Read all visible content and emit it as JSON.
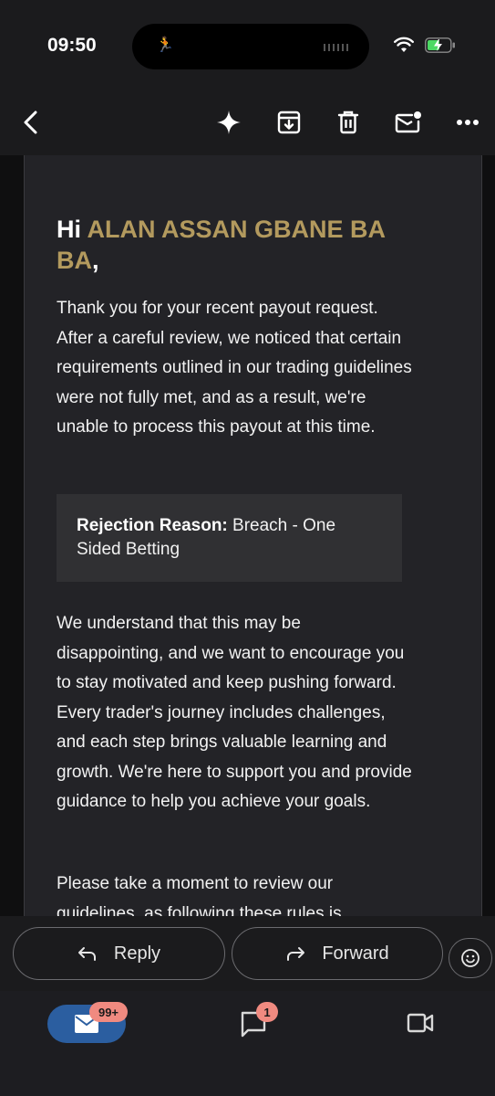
{
  "status_bar": {
    "time": "09:50",
    "icons": [
      "activity-runner-icon",
      "wifi-icon",
      "battery-charging-icon"
    ]
  },
  "toolbar": {
    "icons": [
      "back-arrow-icon",
      "sparkle-icon",
      "archive-icon",
      "delete-icon",
      "mark-unread-icon",
      "more-icon"
    ]
  },
  "email": {
    "greeting_prefix": "Hi",
    "recipient_name": "ALAN ASSAN GBANE BA BA",
    "greeting_suffix": ",",
    "paragraph_1": "Thank you for your recent payout request. After a careful review, we noticed that certain requirements outlined in our trading guidelines were not fully met, and as a result, we're unable to process this payout at this time.",
    "rejection_label": "Rejection Reason:",
    "rejection_value": "Breach - One Sided Betting",
    "paragraph_2": "We understand that this may be disappointing, and we want to encourage you to stay motivated and keep pushing forward. Every trader's journey includes challenges, and each step brings valuable learning and growth. We're here to support you and provide guidance to help you achieve your goals.",
    "paragraph_3": "Please take a moment to review our guidelines, as following these rules is"
  },
  "actions": {
    "reply_label": "Reply",
    "forward_label": "Forward"
  },
  "bottom_nav": {
    "mail_badge": "99+",
    "chat_badge": "1"
  },
  "colors": {
    "accent_name": "#b39a5e",
    "mail_tab": "#2b5ea0",
    "badge": "#f08a80"
  }
}
